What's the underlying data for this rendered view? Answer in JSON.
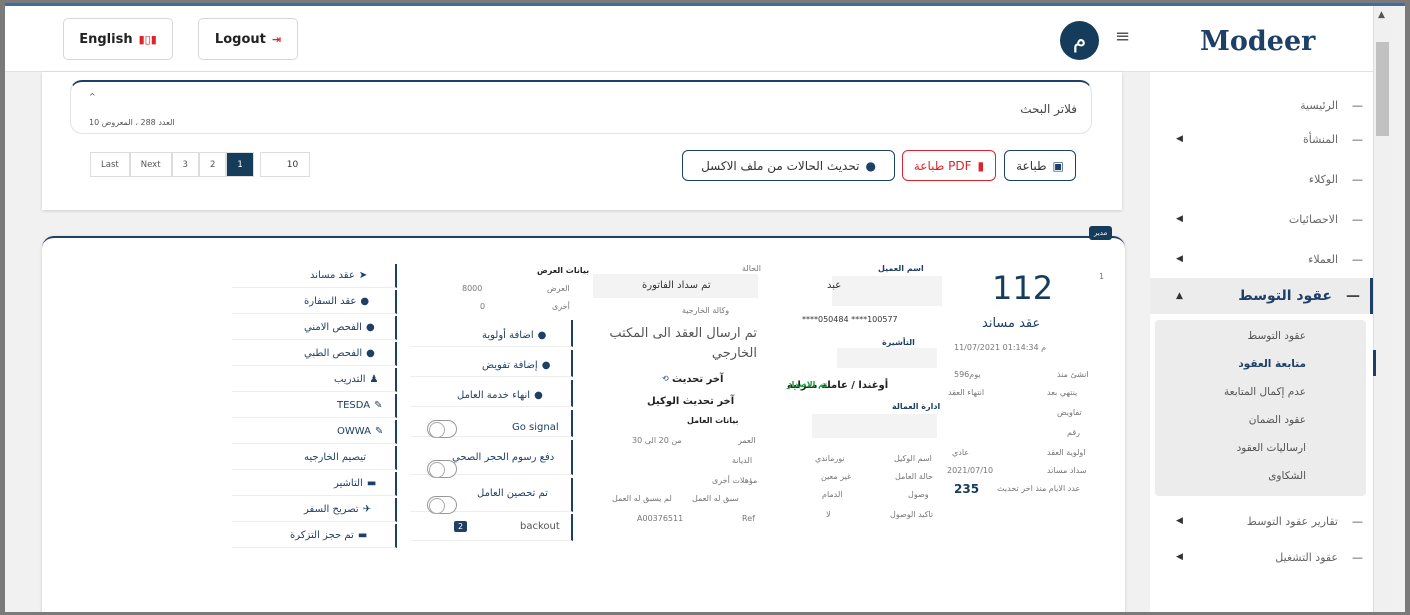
{
  "header": {
    "lang_label": "English",
    "lang_flag": "🇦🇺",
    "logout_label": "Logout",
    "avatar_letter": "م",
    "logo": "Modeer"
  },
  "sidebar": {
    "items": [
      {
        "label": "الرئيسية"
      },
      {
        "label": "المنشأة"
      },
      {
        "label": "الوكلاء"
      },
      {
        "label": "الاحصائيات"
      },
      {
        "label": "العملاء"
      },
      {
        "label": "عقود التوسط"
      },
      {
        "label": "تقارير عقود التوسط"
      },
      {
        "label": "عقود التشغيل"
      }
    ],
    "sub_items": [
      {
        "label": "عقود التوسط"
      },
      {
        "label": "متابعة العقود"
      },
      {
        "label": "عدم إكمال المتابعة"
      },
      {
        "label": "عقود الضمان"
      },
      {
        "label": "ارساليات العقود"
      },
      {
        "label": "الشكاوى"
      }
    ]
  },
  "filters": {
    "title": "فلاتر البحث",
    "count_text": "العدد 288 ، المعروض 10"
  },
  "pager": {
    "last": "Last",
    "next": "Next",
    "p3": "3",
    "p2": "2",
    "p1": "1",
    "size": "10"
  },
  "actions": {
    "print": "طباعة",
    "print_pdf": "طباعة PDF",
    "update_excel": "تحديث الحالات من ملف الاكسل"
  },
  "record": {
    "badge": "مدير",
    "row_no": "1",
    "contract_no": "112",
    "contract_type": "عقد مساند",
    "date": "11/07/2021 01:14:34 م",
    "client_label": "اسم العميل",
    "client_value": "عبد",
    "id_cards": "****050484      ****100577",
    "visa_label": "التأشيرة",
    "worker_title": "أوغندا / عاملة منزلية",
    "worker_status": "تم الاصدار",
    "worker_admin": "ادارة العمالة",
    "days_since_label": "انشئ منذ",
    "days_since": "596يوم",
    "ends_after_label": "ينتهي بعد",
    "ends_after_val": "انتهاء العقد",
    "negotiations": "تفاويض",
    "number": "رقم",
    "priority_label": "اولوية العقد",
    "priority_val": "عادي",
    "type_label": "سداد مساند",
    "type_date": "2021/07/10",
    "days_update_label": "عدد الايام منذ اخر تحديث",
    "days_update": "235",
    "agent_label": "اسم الوكيل",
    "agent_val": "نورماندي",
    "worker_state_label": "حالة العامل",
    "worker_state_val": "غير معين",
    "arrival_label": "وصول",
    "arrival_val": "الدمام",
    "arrival_confirm_label": "تاكيد الوصول",
    "arrival_confirm_val": "لا",
    "status_label": "الحالة",
    "status_val": "تم سداد الفاتورة",
    "ministry_label": "وكالة الخارجية",
    "note": "تم ارسال العقد الى المكتب الخارجي",
    "last_update": "آخر تحديث",
    "last_agent_update": "آخر تحديث الوكيل",
    "worker_data": "بيانات العامل",
    "age_label": "العمر",
    "age_val": "من 20 الى 30",
    "religion_label": "الديانة",
    "other_quals": "مؤهلات أخرى",
    "prev_work_label": "سبق له العمل",
    "prev_work_val": "لم يسبق له العمل",
    "ref_label": "Ref",
    "ref_val": "A00376511",
    "offer_title": "بيانات العرض",
    "offer_label": "العرض",
    "offer_val": "8000",
    "other_label": "أخرى",
    "other_val": "0",
    "add_priority": "اضافة أولوية",
    "add_auth": "إضافة تفويض",
    "end_service": "انهاء خدمة العامل",
    "go_signal": "Go signal",
    "quarantine": "دفع رسوم الحجر الصحي",
    "vaccinated": "تم تحصين العامل",
    "backout": "backout",
    "backout_count": "2",
    "links": [
      "عقد مساند",
      "عقد السفارة",
      "الفحص الامني",
      "الفحص الطبي",
      "التدريب",
      "TESDA",
      "OWWA",
      "تيصيم الخارجيه",
      "التاشير",
      "تصريح السفر",
      "تم حجز التزكرة"
    ]
  }
}
